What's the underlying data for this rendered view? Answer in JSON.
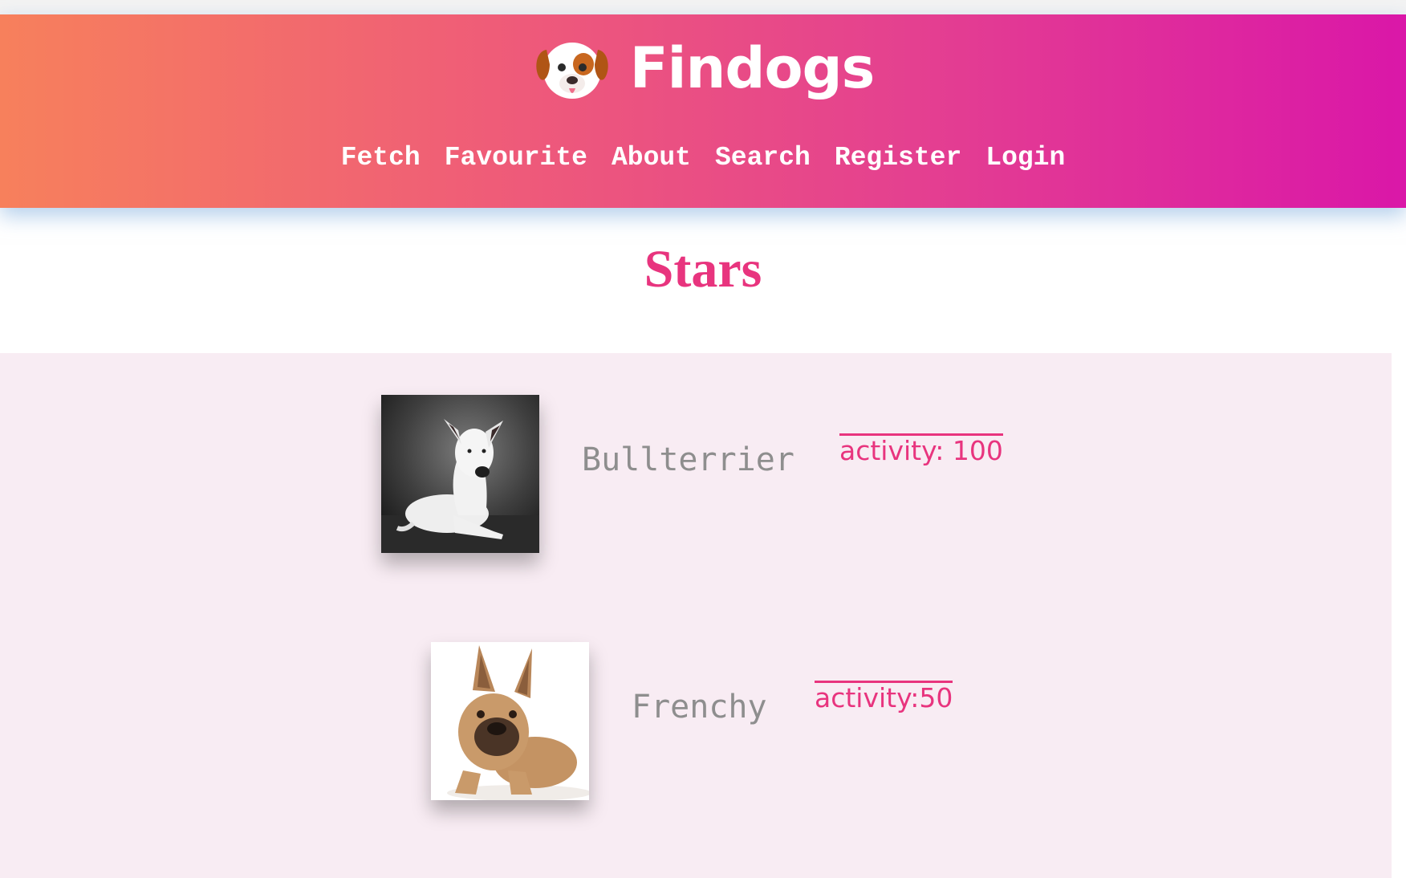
{
  "header": {
    "logo_icon": "dog-face-icon",
    "brand": "Findogs",
    "nav": [
      {
        "label": "Fetch"
      },
      {
        "label": "Favourite"
      },
      {
        "label": "About"
      },
      {
        "label": "Search"
      },
      {
        "label": "Register"
      },
      {
        "label": "Login"
      }
    ]
  },
  "main": {
    "heading": "Stars",
    "dogs": [
      {
        "name": "Bullterrier",
        "activity": "activity: 100",
        "photo": "bullterrier-photo"
      },
      {
        "name": "Frenchy",
        "activity": "activity:50",
        "photo": "french-bulldog-photo"
      }
    ]
  },
  "colors": {
    "gradient_start": "#f7805c",
    "gradient_end": "#da17a8",
    "accent": "#e8347e",
    "list_background": "#f8ecf3",
    "name_text": "#8e8e8e"
  }
}
